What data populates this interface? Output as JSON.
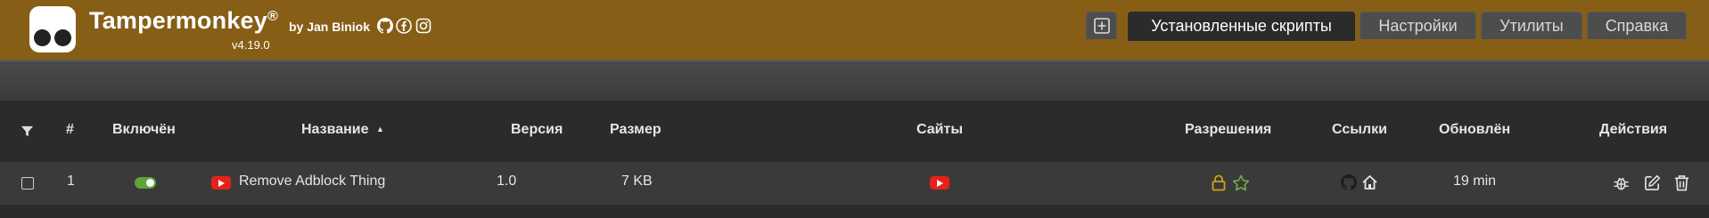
{
  "header": {
    "app_name": "Tampermonkey",
    "registered": "®",
    "by_author": "by Jan Biniok",
    "version": "v4.19.0",
    "social_icons": [
      "github-icon",
      "facebook-icon",
      "instagram-icon"
    ],
    "bg_color": "#865e16"
  },
  "tabs": [
    {
      "icon": "plus-icon"
    },
    {
      "label": "Установленные скрипты",
      "active": true
    },
    {
      "label": "Настройки"
    },
    {
      "label": "Утилиты"
    },
    {
      "label": "Справка"
    }
  ],
  "table": {
    "headers": {
      "filter_icon": "filter-icon",
      "number": "#",
      "enabled": "Включён",
      "name": "Название",
      "sort_indicator": "▲",
      "version": "Версия",
      "size": "Размер",
      "sites": "Сайты",
      "permissions": "Разрешения",
      "links": "Ссылки",
      "updated": "Обновлён",
      "actions": "Действия"
    },
    "rows": [
      {
        "selected": false,
        "number": "1",
        "enabled": true,
        "name": "Remove Adblock Thing",
        "version": "1.0",
        "size": "7 KB",
        "site_icon": "youtube-icon",
        "permission_icons": [
          "lock-icon",
          "star-icon"
        ],
        "link_icons": [
          "github-icon",
          "home-icon"
        ],
        "updated": "19 min",
        "action_icons": [
          "debug-icon",
          "edit-icon",
          "delete-icon"
        ]
      }
    ]
  },
  "colors": {
    "toggle_on": "#5fa33a",
    "lock": "#d4a017",
    "star": "#6ab04c",
    "youtube": "#e62117"
  }
}
